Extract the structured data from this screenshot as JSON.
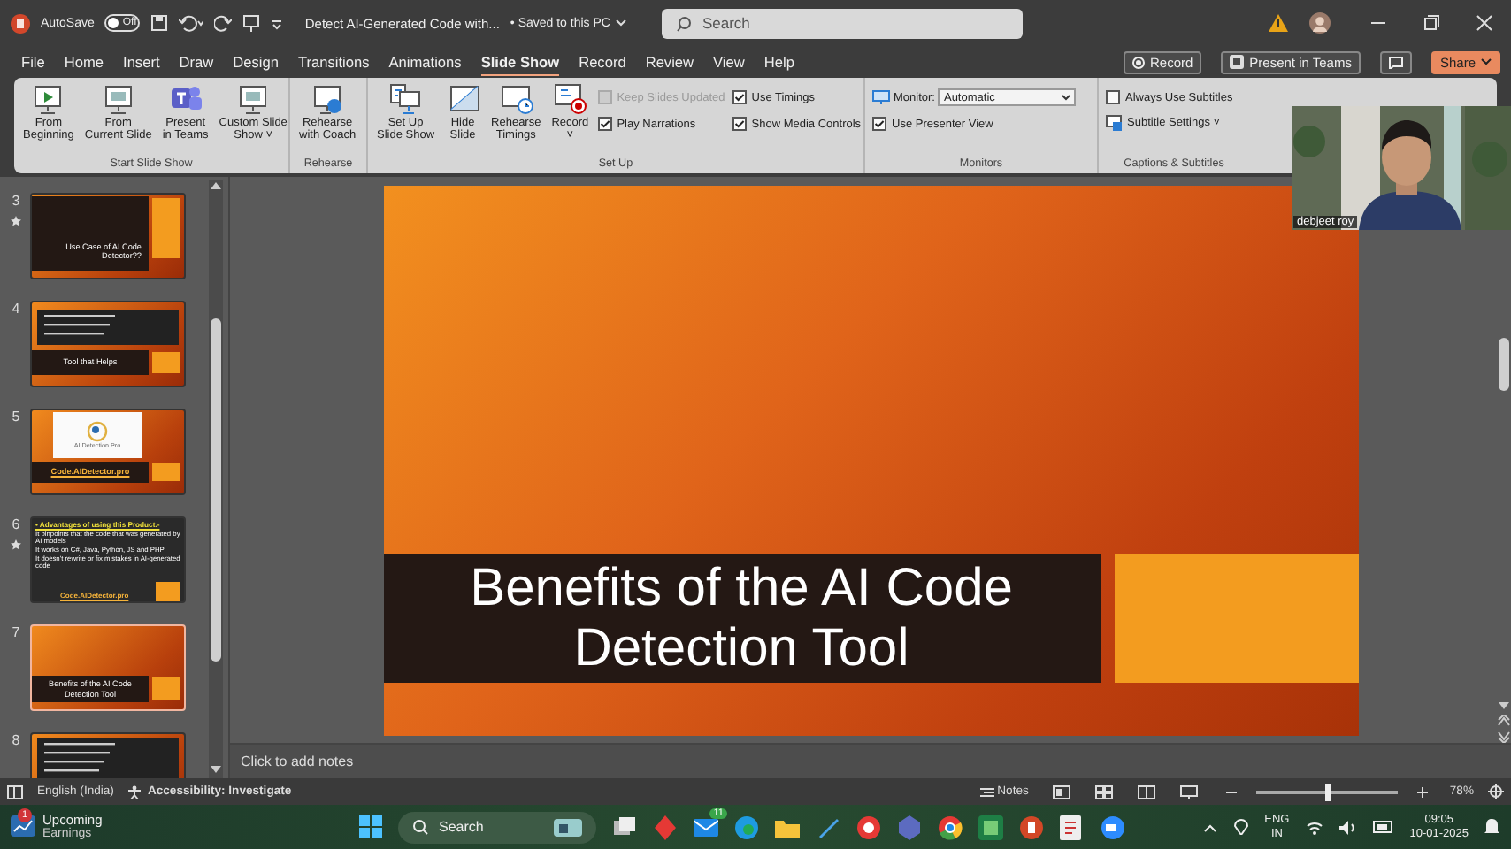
{
  "title_bar": {
    "autosave_label": "AutoSave",
    "autosave": {
      "label": "Off",
      "on": false
    },
    "document_title": "Detect AI-Generated Code with...",
    "save_status": "• Saved to this PC",
    "search": {
      "placeholder": "Search"
    }
  },
  "menu_tabs": [
    {
      "label": "File",
      "selected": false
    },
    {
      "label": "Home",
      "selected": false
    },
    {
      "label": "Insert",
      "selected": false
    },
    {
      "label": "Draw",
      "selected": false
    },
    {
      "label": "Design",
      "selected": false
    },
    {
      "label": "Transitions",
      "selected": false
    },
    {
      "label": "Animations",
      "selected": false
    },
    {
      "label": "Slide Show",
      "selected": true
    },
    {
      "label": "Record",
      "selected": false
    },
    {
      "label": "Review",
      "selected": false
    },
    {
      "label": "View",
      "selected": false
    },
    {
      "label": "Help",
      "selected": false
    }
  ],
  "menu_actions": [
    {
      "kind": "record",
      "label": "Record"
    },
    {
      "kind": "teams",
      "label": "Present in Teams"
    },
    {
      "kind": "comment"
    },
    {
      "kind": "share",
      "label": "Share"
    }
  ],
  "ribbon_groups": [
    {
      "name": "Start Slide Show",
      "items": [
        {
          "kind": "big",
          "label": "From\nBeginning"
        },
        {
          "kind": "big",
          "label": "From\nCurrent Slide"
        },
        {
          "kind": "big",
          "label": "Present\nin Teams"
        },
        {
          "kind": "big",
          "label": "Custom Slide\nShow ˅"
        }
      ]
    },
    {
      "name": "Rehearse",
      "items": [
        {
          "kind": "big",
          "label": "Rehearse\nwith Coach"
        }
      ]
    },
    {
      "name": "Set Up",
      "items": [
        {
          "kind": "big",
          "label": "Set Up\nSlide Show"
        },
        {
          "kind": "big",
          "label": "Hide\nSlide"
        },
        {
          "kind": "big",
          "label": "Rehearse\nTimings"
        },
        {
          "kind": "big",
          "label": "Record\n˅"
        },
        {
          "kind": "checks",
          "items": [
            {
              "label": "Keep Slides Updated",
              "checked": false,
              "disabled": true
            },
            {
              "label": "Play Narrations",
              "checked": true,
              "disabled": false
            }
          ]
        },
        {
          "kind": "checks",
          "items": [
            {
              "label": "Use Timings",
              "checked": true,
              "disabled": false
            },
            {
              "label": "Show Media Controls",
              "checked": true,
              "disabled": false
            }
          ]
        }
      ]
    },
    {
      "name": "Monitors",
      "items": [
        {
          "kind": "monitor",
          "label": "Monitor:",
          "value": "Automatic",
          "checkbox": {
            "label": "Use Presenter View",
            "checked": true,
            "disabled": false
          }
        }
      ]
    },
    {
      "name": "Captions & Subtitles",
      "items": [
        {
          "kind": "checks",
          "items": [
            {
              "label": "Always Use Subtitles",
              "checked": false,
              "disabled": false
            }
          ]
        },
        {
          "kind": "subtitle",
          "label": "Subtitle Settings ˅"
        }
      ]
    }
  ],
  "slides": [
    {
      "number": "3",
      "animated": true,
      "selected": false,
      "kind": "title_card",
      "title": "Use Case of AI Code Detector??"
    },
    {
      "number": "4",
      "animated": false,
      "selected": false,
      "kind": "bullets_band",
      "title": "Tool that Helps"
    },
    {
      "number": "5",
      "animated": false,
      "selected": false,
      "kind": "logo_band",
      "logo_text": "AI Detection Pro",
      "title": "Code.AIDetector.pro"
    },
    {
      "number": "6",
      "animated": true,
      "selected": false,
      "kind": "bullet_list",
      "heading": "• Advantages of using this Product.-",
      "bullets": [
        "It pinpoints that the code that was generated by AI models",
        "It works on C#, Java, Python, JS and PHP",
        "It doesn't rewrite or fix mistakes in AI-generated code"
      ],
      "title": "Code.AIDetector.pro"
    },
    {
      "number": "7",
      "animated": false,
      "selected": true,
      "kind": "title_band",
      "title": "Benefits of the AI Code Detection Tool"
    },
    {
      "number": "8",
      "animated": false,
      "selected": false,
      "kind": "lines"
    }
  ],
  "current_slide": {
    "title": "Benefits of the AI Code Detection Tool"
  },
  "notes": {
    "placeholder": "Click to add notes"
  },
  "webcam": {
    "kind": "picture",
    "name": "debjeet roy"
  },
  "status_bar": {
    "language": "English (India)",
    "accessibility": "Accessibility: Investigate",
    "notes": "Notes",
    "zoom": {
      "level": 0.5
    },
    "zoom_percent": "78%"
  },
  "taskbar": {
    "widget": {
      "badge": "1",
      "title": "Upcoming",
      "subtitle": "Earnings"
    },
    "search": "Search",
    "mail_badge": "11",
    "language": "ENG",
    "region": "IN",
    "time": "09:05",
    "date": "10-01-2025"
  }
}
